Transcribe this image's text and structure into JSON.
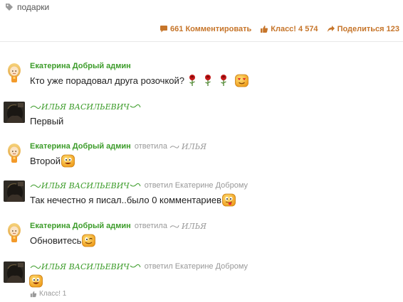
{
  "tag": {
    "label": "подарки",
    "icon": "tag-icon"
  },
  "actions": {
    "comment": {
      "label": "661 Комментировать",
      "icon": "speech-bubble-icon"
    },
    "like": {
      "label": "Класс! 4 574",
      "icon": "thumbs-up-icon"
    },
    "share": {
      "label": "Поделиться 123",
      "icon": "share-arrow-icon"
    }
  },
  "colors": {
    "accent": "#c6752a",
    "author": "#3c9c2a",
    "muted": "#999999"
  },
  "comments": [
    {
      "author": "Екатерина Добрый админ",
      "text": "Кто уже порадовал друга розочкой?",
      "reply_label": "",
      "reply_to": ""
    },
    {
      "author": "ИЛЬЯ ВАСИЛЬЕВИЧ",
      "text": "Первый",
      "reply_label": "",
      "reply_to": ""
    },
    {
      "author": "Екатерина Добрый админ",
      "text": "Второй",
      "reply_label": "ответила",
      "reply_to": "ИЛЬЯ"
    },
    {
      "author": "ИЛЬЯ ВАСИЛЬЕВИЧ",
      "text": "Так нечестно я писал..было 0 комментариев",
      "reply_label": "ответил",
      "reply_to": "Екатерине Доброму"
    },
    {
      "author": "Екатерина Добрый админ",
      "text": "Обновитесь",
      "reply_label": "ответила",
      "reply_to": "ИЛЬЯ"
    },
    {
      "author": "ИЛЬЯ ВАСИЛЬЕВИЧ",
      "text": "",
      "reply_label": "ответил",
      "reply_to": "Екатерине Доброму"
    }
  ],
  "last_comment_like": {
    "label": "Класс! 1",
    "icon": "thumbs-up-icon"
  }
}
